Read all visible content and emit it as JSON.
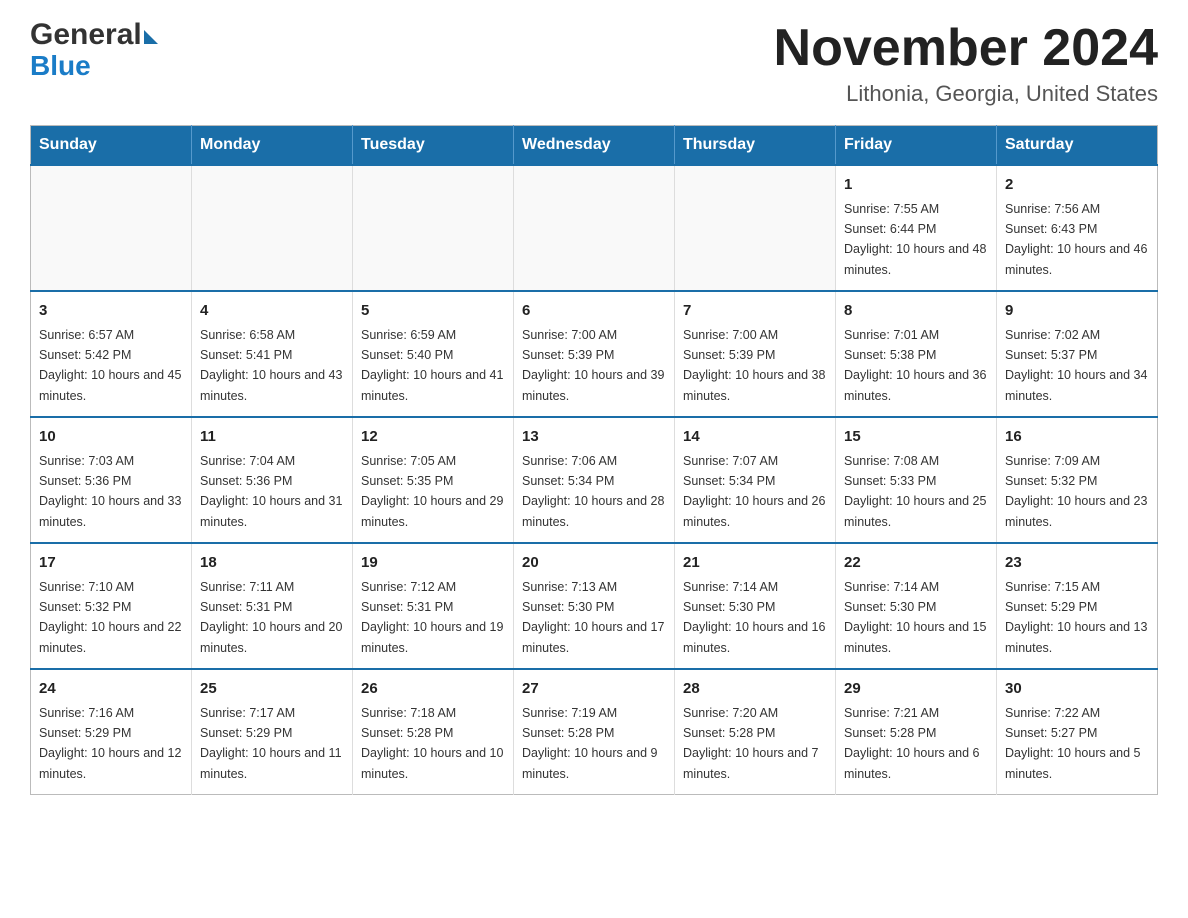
{
  "logo": {
    "text_general": "General",
    "text_blue": "Blue"
  },
  "header": {
    "month_title": "November 2024",
    "location": "Lithonia, Georgia, United States"
  },
  "weekdays": [
    "Sunday",
    "Monday",
    "Tuesday",
    "Wednesday",
    "Thursday",
    "Friday",
    "Saturday"
  ],
  "weeks": [
    [
      {
        "day": "",
        "info": ""
      },
      {
        "day": "",
        "info": ""
      },
      {
        "day": "",
        "info": ""
      },
      {
        "day": "",
        "info": ""
      },
      {
        "day": "",
        "info": ""
      },
      {
        "day": "1",
        "info": "Sunrise: 7:55 AM\nSunset: 6:44 PM\nDaylight: 10 hours and 48 minutes."
      },
      {
        "day": "2",
        "info": "Sunrise: 7:56 AM\nSunset: 6:43 PM\nDaylight: 10 hours and 46 minutes."
      }
    ],
    [
      {
        "day": "3",
        "info": "Sunrise: 6:57 AM\nSunset: 5:42 PM\nDaylight: 10 hours and 45 minutes."
      },
      {
        "day": "4",
        "info": "Sunrise: 6:58 AM\nSunset: 5:41 PM\nDaylight: 10 hours and 43 minutes."
      },
      {
        "day": "5",
        "info": "Sunrise: 6:59 AM\nSunset: 5:40 PM\nDaylight: 10 hours and 41 minutes."
      },
      {
        "day": "6",
        "info": "Sunrise: 7:00 AM\nSunset: 5:39 PM\nDaylight: 10 hours and 39 minutes."
      },
      {
        "day": "7",
        "info": "Sunrise: 7:00 AM\nSunset: 5:39 PM\nDaylight: 10 hours and 38 minutes."
      },
      {
        "day": "8",
        "info": "Sunrise: 7:01 AM\nSunset: 5:38 PM\nDaylight: 10 hours and 36 minutes."
      },
      {
        "day": "9",
        "info": "Sunrise: 7:02 AM\nSunset: 5:37 PM\nDaylight: 10 hours and 34 minutes."
      }
    ],
    [
      {
        "day": "10",
        "info": "Sunrise: 7:03 AM\nSunset: 5:36 PM\nDaylight: 10 hours and 33 minutes."
      },
      {
        "day": "11",
        "info": "Sunrise: 7:04 AM\nSunset: 5:36 PM\nDaylight: 10 hours and 31 minutes."
      },
      {
        "day": "12",
        "info": "Sunrise: 7:05 AM\nSunset: 5:35 PM\nDaylight: 10 hours and 29 minutes."
      },
      {
        "day": "13",
        "info": "Sunrise: 7:06 AM\nSunset: 5:34 PM\nDaylight: 10 hours and 28 minutes."
      },
      {
        "day": "14",
        "info": "Sunrise: 7:07 AM\nSunset: 5:34 PM\nDaylight: 10 hours and 26 minutes."
      },
      {
        "day": "15",
        "info": "Sunrise: 7:08 AM\nSunset: 5:33 PM\nDaylight: 10 hours and 25 minutes."
      },
      {
        "day": "16",
        "info": "Sunrise: 7:09 AM\nSunset: 5:32 PM\nDaylight: 10 hours and 23 minutes."
      }
    ],
    [
      {
        "day": "17",
        "info": "Sunrise: 7:10 AM\nSunset: 5:32 PM\nDaylight: 10 hours and 22 minutes."
      },
      {
        "day": "18",
        "info": "Sunrise: 7:11 AM\nSunset: 5:31 PM\nDaylight: 10 hours and 20 minutes."
      },
      {
        "day": "19",
        "info": "Sunrise: 7:12 AM\nSunset: 5:31 PM\nDaylight: 10 hours and 19 minutes."
      },
      {
        "day": "20",
        "info": "Sunrise: 7:13 AM\nSunset: 5:30 PM\nDaylight: 10 hours and 17 minutes."
      },
      {
        "day": "21",
        "info": "Sunrise: 7:14 AM\nSunset: 5:30 PM\nDaylight: 10 hours and 16 minutes."
      },
      {
        "day": "22",
        "info": "Sunrise: 7:14 AM\nSunset: 5:30 PM\nDaylight: 10 hours and 15 minutes."
      },
      {
        "day": "23",
        "info": "Sunrise: 7:15 AM\nSunset: 5:29 PM\nDaylight: 10 hours and 13 minutes."
      }
    ],
    [
      {
        "day": "24",
        "info": "Sunrise: 7:16 AM\nSunset: 5:29 PM\nDaylight: 10 hours and 12 minutes."
      },
      {
        "day": "25",
        "info": "Sunrise: 7:17 AM\nSunset: 5:29 PM\nDaylight: 10 hours and 11 minutes."
      },
      {
        "day": "26",
        "info": "Sunrise: 7:18 AM\nSunset: 5:28 PM\nDaylight: 10 hours and 10 minutes."
      },
      {
        "day": "27",
        "info": "Sunrise: 7:19 AM\nSunset: 5:28 PM\nDaylight: 10 hours and 9 minutes."
      },
      {
        "day": "28",
        "info": "Sunrise: 7:20 AM\nSunset: 5:28 PM\nDaylight: 10 hours and 7 minutes."
      },
      {
        "day": "29",
        "info": "Sunrise: 7:21 AM\nSunset: 5:28 PM\nDaylight: 10 hours and 6 minutes."
      },
      {
        "day": "30",
        "info": "Sunrise: 7:22 AM\nSunset: 5:27 PM\nDaylight: 10 hours and 5 minutes."
      }
    ]
  ]
}
